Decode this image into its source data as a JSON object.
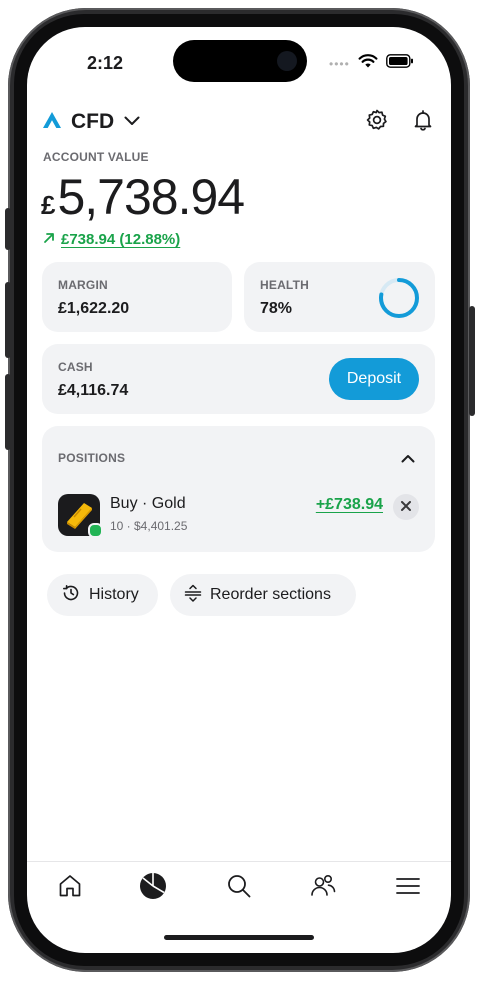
{
  "status": {
    "time": "2:12",
    "dots": "••••"
  },
  "header": {
    "title": "CFD",
    "icons": [
      "logo-icon",
      "chevron-down-icon",
      "gear-icon",
      "bell-icon"
    ]
  },
  "account": {
    "label": "ACCOUNT VALUE",
    "currency": "£",
    "amount": "5,738.94",
    "change": "£738.94 (12.88%)"
  },
  "margin": {
    "label": "MARGIN",
    "value": "£1,622.20"
  },
  "health": {
    "label": "HEALTH",
    "value": "78%",
    "level": 0.78
  },
  "cash": {
    "label": "CASH",
    "value": "£4,116.74",
    "deposit_label": "Deposit"
  },
  "positions": {
    "label": "POSITIONS",
    "items": [
      {
        "title": "Buy · Gold",
        "subtitle": "10 · $4,401.25",
        "pnl": "+£738.94"
      }
    ]
  },
  "actions": {
    "history_label": "History",
    "reorder_label": "Reorder sections"
  },
  "tabs": [
    "home-icon",
    "portfolio-icon",
    "search-icon",
    "community-icon",
    "menu-icon"
  ],
  "colors": {
    "accent": "#139bd8",
    "positive": "#1aa34a",
    "card": "#f2f3f5"
  }
}
